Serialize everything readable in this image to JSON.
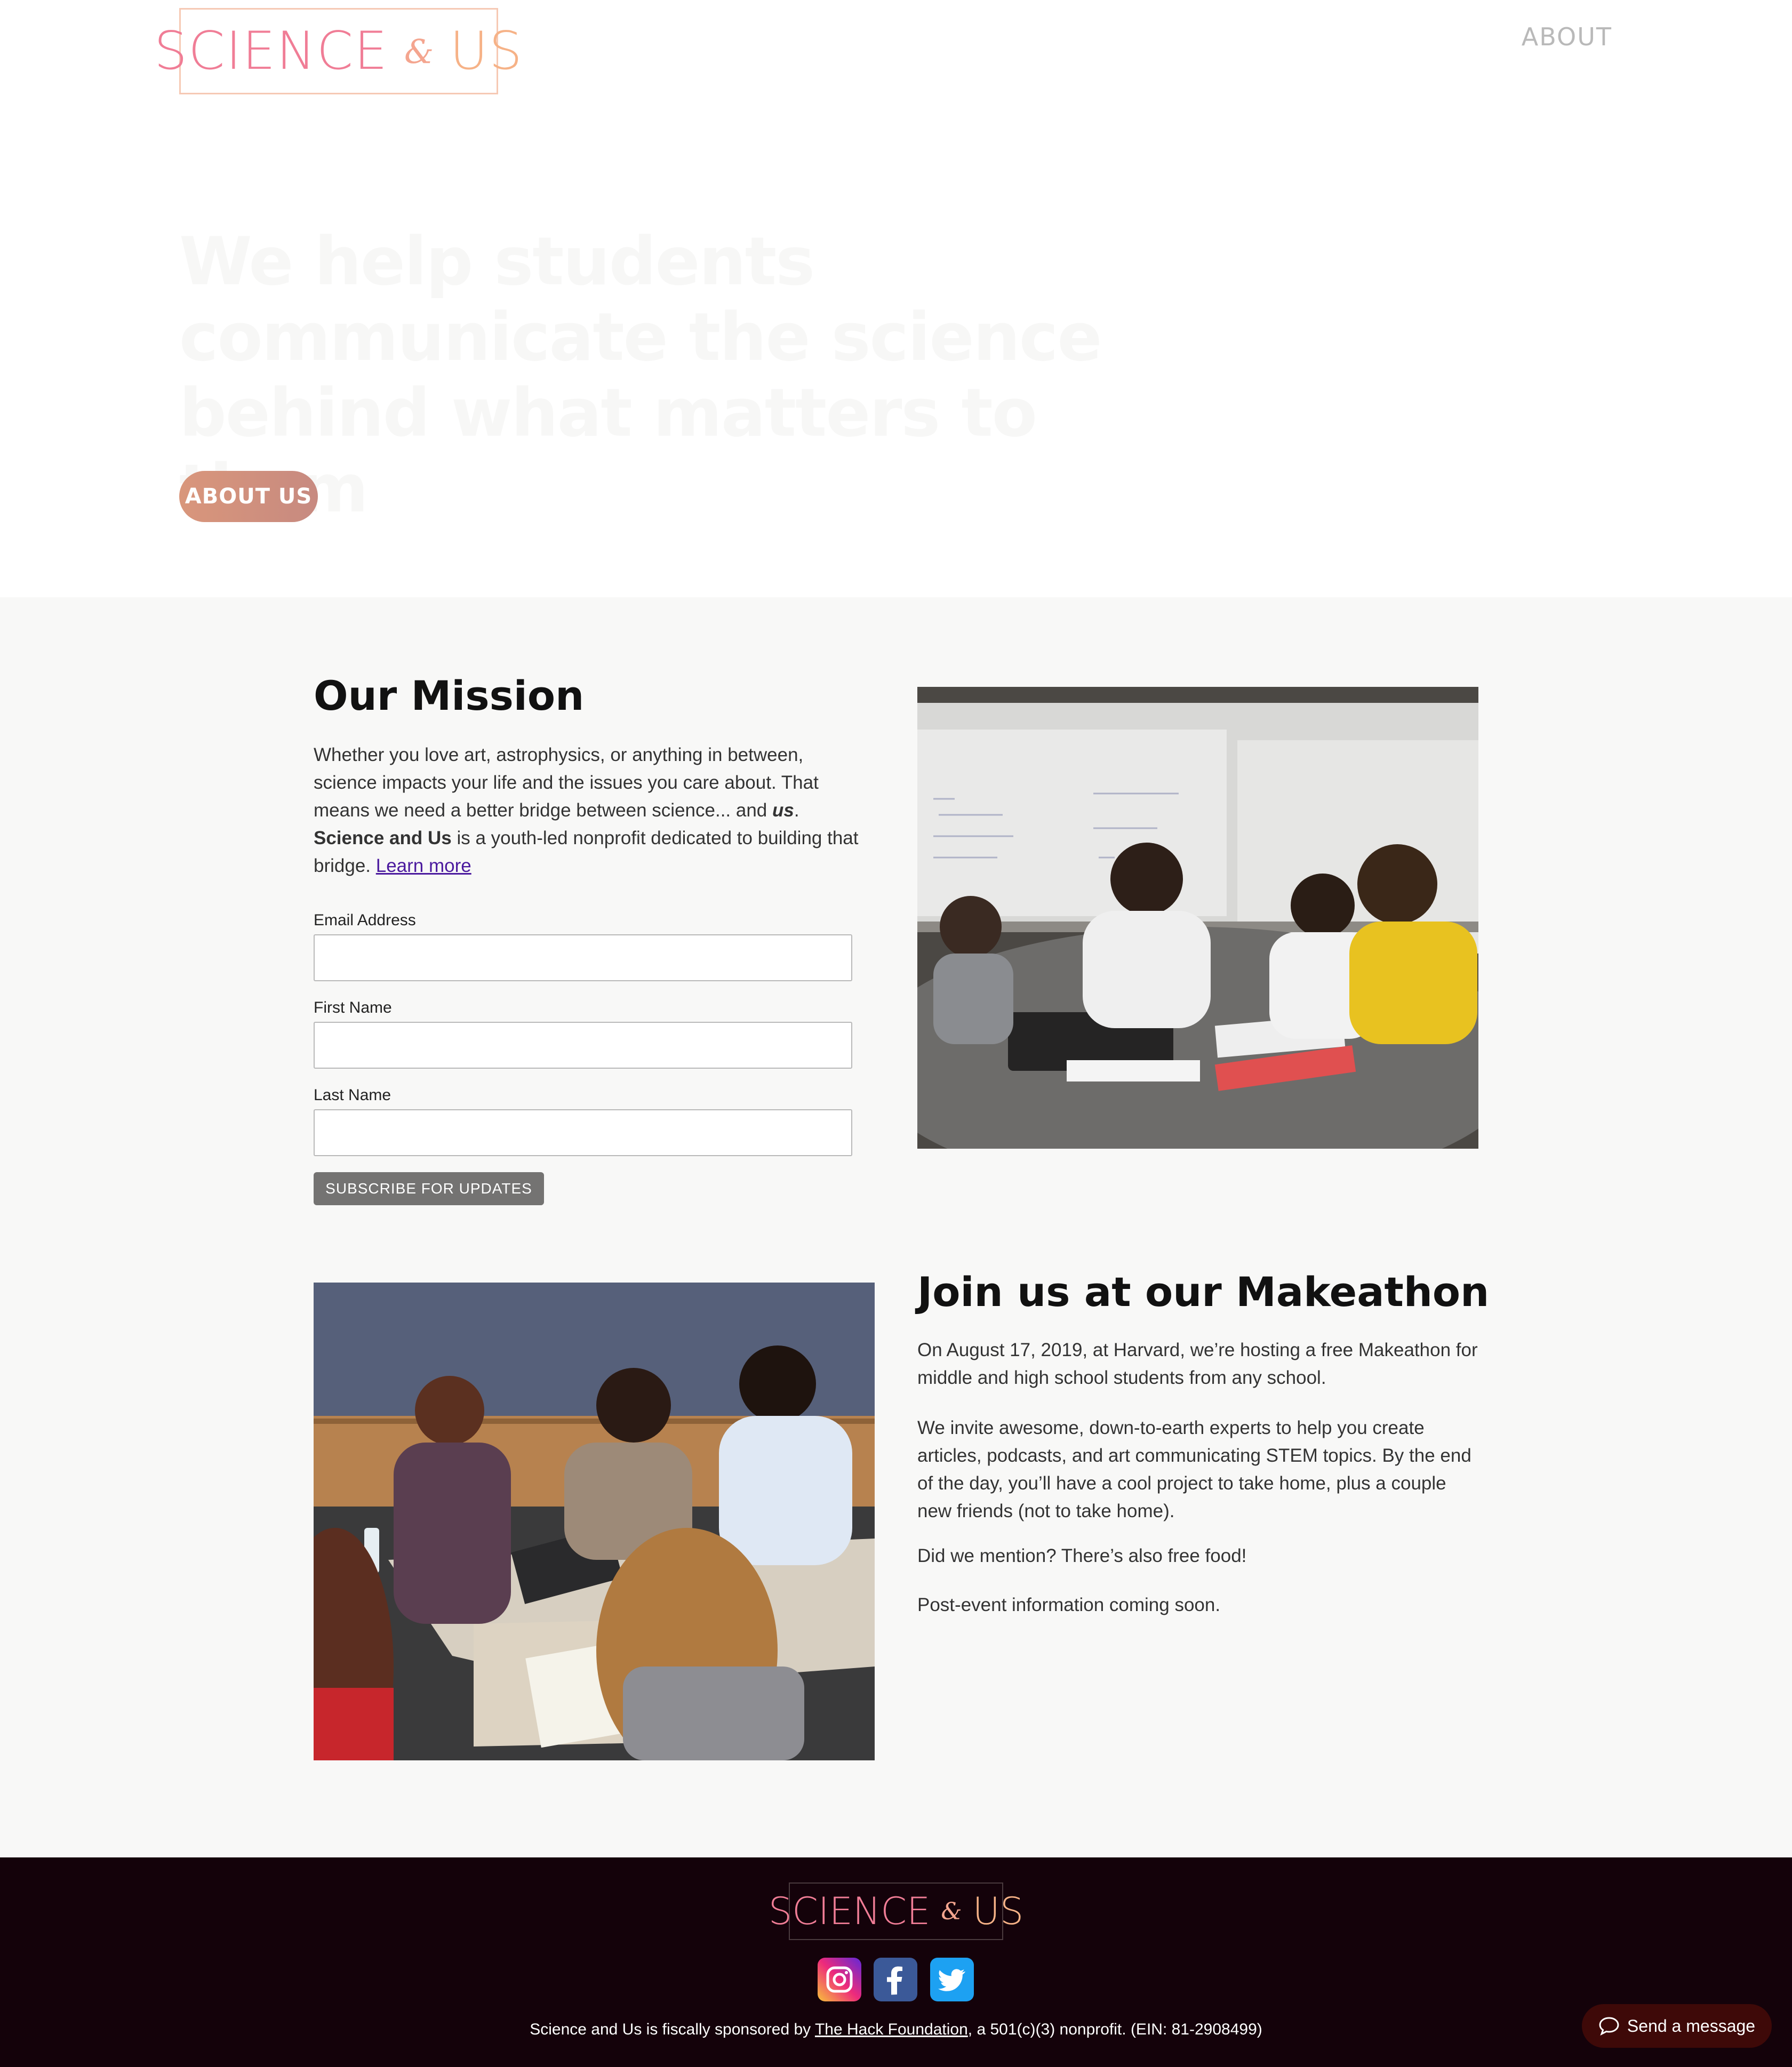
{
  "header": {
    "logo_science": "SCIENCE",
    "logo_amp": "&",
    "logo_us": "US",
    "nav_about": "ABOUT"
  },
  "hero": {
    "title": "We help students communicate the science behind what matters to them",
    "button": "ABOUT US"
  },
  "mission": {
    "title": "Our Mission",
    "text_1": "Whether you love art, astrophysics, or anything in between, science impacts your life and the issues you care about. That means we need a better bridge between science... and ",
    "text_us": "us",
    "text_2": ".",
    "org_name": "Science and Us",
    "text_3": " is a youth-led nonprofit dedicated to building that bridge. ",
    "learn_more": "Learn more",
    "form": {
      "email_label": "Email Address",
      "first_label": "First Name",
      "last_label": "Last Name",
      "email_value": "",
      "first_value": "",
      "last_value": "",
      "submit": "SUBSCRIBE FOR UPDATES"
    }
  },
  "makeathon": {
    "title": "Join us at our Makeathon",
    "p1": "On August 17, 2019, at Harvard, we’re hosting a free Makeathon for middle and high school students from any school.",
    "p2": "We invite awesome, down-to-earth experts to help you create articles, podcasts, and art communicating STEM topics. By the end of the day, you’ll have a cool project to take home, plus a couple new friends (not to take home).",
    "p3": "Did we mention? There’s also free food!",
    "p4": "Post-event information coming soon."
  },
  "footer": {
    "logo_science": "SCIENCE",
    "logo_amp": "&",
    "logo_us": "US",
    "social": [
      "instagram-icon",
      "facebook-icon",
      "twitter-icon"
    ],
    "text_1": "Science and Us is fiscally sponsored by ",
    "hack_link": "The Hack Foundation",
    "text_2": ", a 501(c)(3) nonprofit. (EIN: 81-2908499)"
  },
  "chat": {
    "label": "Send a message"
  },
  "colors": {
    "logo_pink": "#f07d96",
    "logo_orange": "#f6b287",
    "button_gradient_start": "#d9967b",
    "button_gradient_end": "#c78a80",
    "section_bg": "#f8f8f7",
    "footer_bg": "#14020a",
    "chat_bg": "#3e0908",
    "link_purple": "#4b1a9e"
  }
}
